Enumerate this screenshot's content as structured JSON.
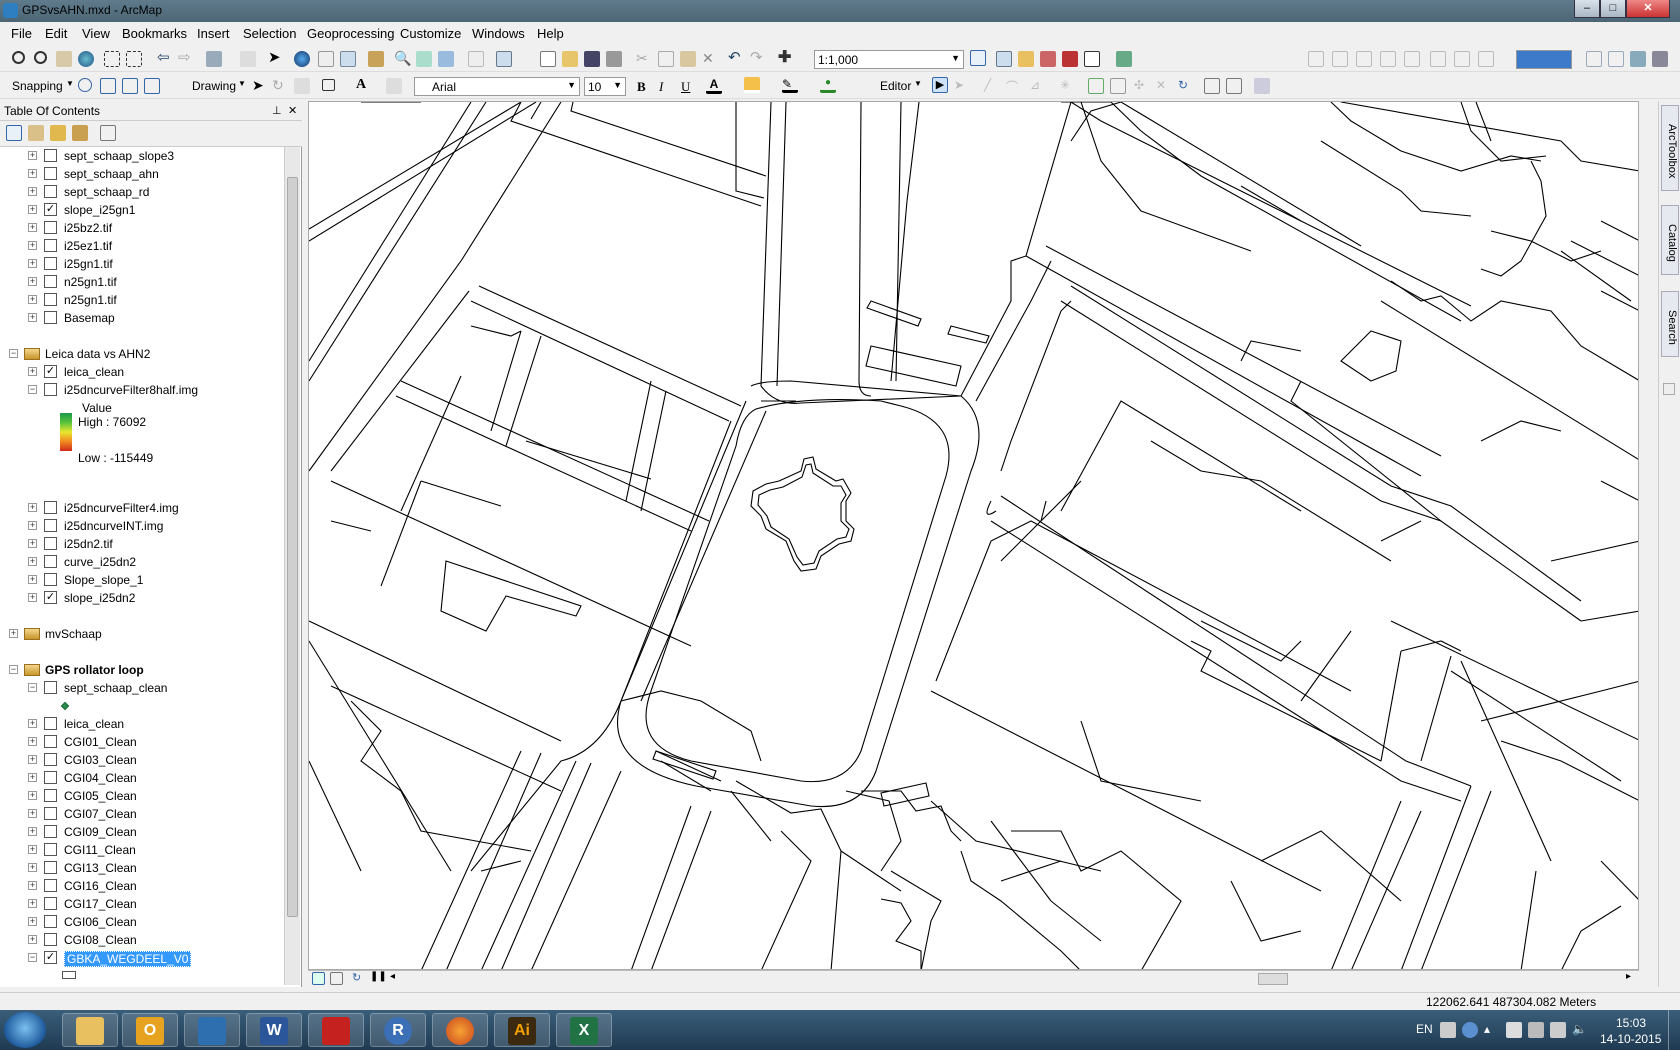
{
  "window": {
    "title": "GPSvsAHN.mxd - ArcMap",
    "min": "–",
    "max": "□",
    "close": "✕"
  },
  "menu": [
    "File",
    "Edit",
    "View",
    "Bookmarks",
    "Insert",
    "Selection",
    "Geoprocessing",
    "Customize",
    "Windows",
    "Help"
  ],
  "toolbar": {
    "scale": "1:1,000",
    "snapping_label": "Snapping",
    "drawing_label": "Drawing",
    "font_name": "Arial",
    "font_size": "10",
    "bold": "B",
    "italic": "I",
    "underline": "U",
    "editor_label": "Editor"
  },
  "toc": {
    "title": "Table Of Contents",
    "pin": "⊥",
    "close": "✕",
    "rows": [
      {
        "label": "sept_schaap_slope3",
        "checked": false
      },
      {
        "label": "sept_schaap_ahn",
        "checked": false
      },
      {
        "label": "sept_schaap_rd",
        "checked": false
      },
      {
        "label": "slope_i25gn1",
        "checked": true
      },
      {
        "label": "i25bz2.tif",
        "checked": false
      },
      {
        "label": "i25ez1.tif",
        "checked": false
      },
      {
        "label": "i25gn1.tif",
        "checked": false
      },
      {
        "label": "n25gn1.tif",
        "checked": false
      },
      {
        "label": "n25gn1.tif",
        "checked": false
      },
      {
        "label": "Basemap",
        "checked": false
      }
    ],
    "group1": {
      "label": "Leica data vs AHN2"
    },
    "group1_rows": [
      {
        "label": "leica_clean",
        "checked": true
      },
      {
        "label": "i25dncurveFilter8half.img",
        "checked": false
      }
    ],
    "legend": {
      "value_label": "Value",
      "high": "High : 76092",
      "low": "Low : -115449"
    },
    "group1_rows2": [
      {
        "label": "i25dncurveFilter4.img",
        "checked": false
      },
      {
        "label": "i25dncurveINT.img",
        "checked": false
      },
      {
        "label": "i25dn2.tif",
        "checked": false
      },
      {
        "label": "curve_i25dn2",
        "checked": false
      },
      {
        "label": "Slope_slope_1",
        "checked": false
      },
      {
        "label": "slope_i25dn2",
        "checked": true
      }
    ],
    "group2": {
      "label": "mvSchaap"
    },
    "group3": {
      "label": "GPS rollator loop"
    },
    "group3_rows": [
      {
        "label": "sept_schaap_clean",
        "checked": false
      },
      {
        "label": "leica_clean",
        "checked": false
      },
      {
        "label": "CGI01_Clean",
        "checked": false
      },
      {
        "label": "CGI03_Clean",
        "checked": false
      },
      {
        "label": "CGI04_Clean",
        "checked": false
      },
      {
        "label": "CGI05_Clean",
        "checked": false
      },
      {
        "label": "CGI07_Clean",
        "checked": false
      },
      {
        "label": "CGI09_Clean",
        "checked": false
      },
      {
        "label": "CGI11_Clean",
        "checked": false
      },
      {
        "label": "CGI13_Clean",
        "checked": false
      },
      {
        "label": "CGI16_Clean",
        "checked": false
      },
      {
        "label": "CGI17_Clean",
        "checked": false
      },
      {
        "label": "CGI06_Clean",
        "checked": false
      },
      {
        "label": "CGI08_Clean",
        "checked": false
      },
      {
        "label": "GBKA_WEGDEEL_V0",
        "checked": true,
        "selected": true
      }
    ]
  },
  "right_tabs": [
    "ArcToolbox",
    "Catalog",
    "Search"
  ],
  "status": {
    "coords": "122062.641  487304.082 Meters"
  },
  "tray": {
    "lang": "EN",
    "time": "15:03",
    "date": "14-10-2015"
  },
  "taskbar_apps": [
    "explorer-icon",
    "outlook-icon",
    "search-icon",
    "word-icon",
    "acrobat-icon",
    "r-icon",
    "firefox-icon",
    "illustrator-icon",
    "excel-icon"
  ],
  "taskbar_letters": {
    "word": "W",
    "r": "R",
    "ai": "Ai",
    "excel": "X",
    "outlook": "O"
  }
}
